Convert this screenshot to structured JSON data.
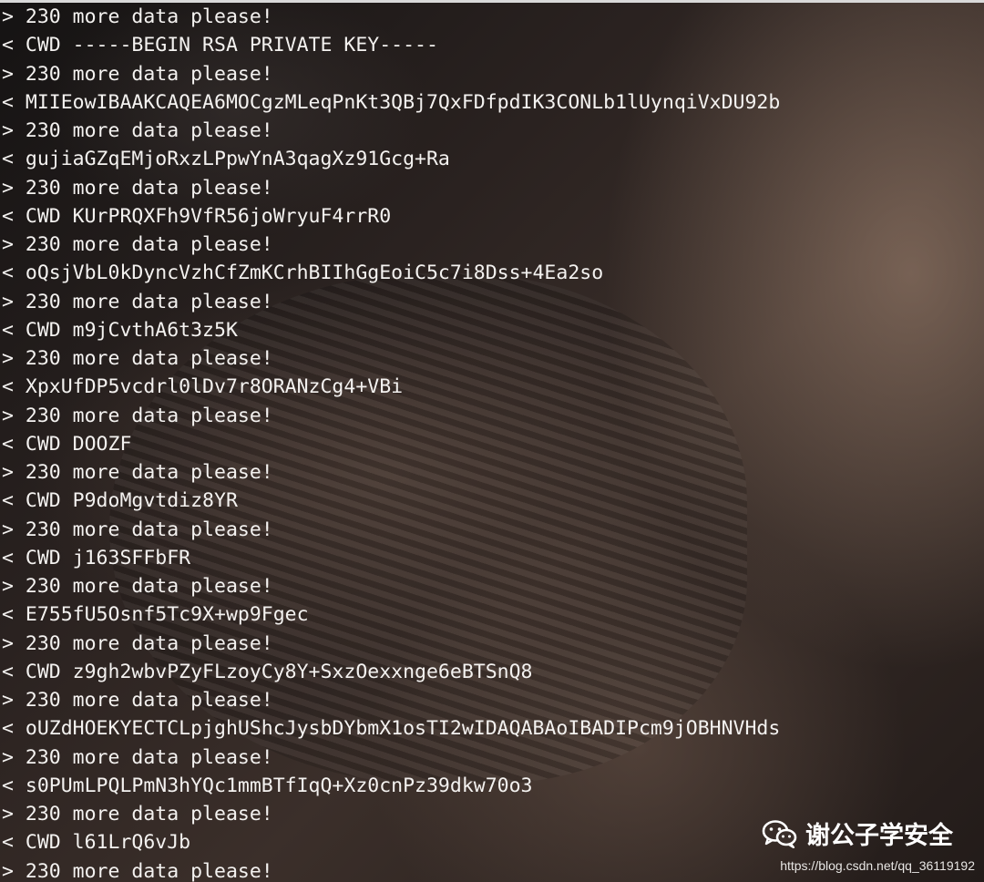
{
  "terminal": {
    "lines": [
      "> 230 more data please!",
      "< CWD -----BEGIN RSA PRIVATE KEY-----",
      "> 230 more data please!",
      "< MIIEowIBAAKCAQEA6MOCgzMLeqPnKt3QBj7QxFDfpdIK3CONLb1lUynqiVxDU92b",
      "> 230 more data please!",
      "< gujiaGZqEMjoRxzLPpwYnA3qagXz91Gcg+Ra",
      "> 230 more data please!",
      "< CWD KUrPRQXFh9VfR56joWryuF4rrR0",
      "> 230 more data please!",
      "< oQsjVbL0kDyncVzhCfZmKCrhBIIhGgEoiC5c7i8Dss+4Ea2so",
      "> 230 more data please!",
      "< CWD m9jCvthA6t3z5K",
      "> 230 more data please!",
      "< XpxUfDP5vcdrl0lDv7r8ORANzCg4+VBi",
      "> 230 more data please!",
      "< CWD DOOZF",
      "> 230 more data please!",
      "< CWD P9doMgvtdiz8YR",
      "> 230 more data please!",
      "< CWD j163SFFbFR",
      "> 230 more data please!",
      "< E755fU5Osnf5Tc9X+wp9Fgec",
      "> 230 more data please!",
      "< CWD z9gh2wbvPZyFLzoyCy8Y+SxzOexxnge6eBTSnQ8",
      "> 230 more data please!",
      "< oUZdHOEKYECTCLpjghUShcJysbDYbmX1osTI2wIDAQABAoIBADIPcm9jOBHNVHds",
      "> 230 more data please!",
      "< s0PUmLPQLPmN3hYQc1mmBTfIqQ+Xz0cnPz39dkw70o3",
      "> 230 more data please!",
      "< CWD l61LrQ6vJb",
      "> 230 more data please!"
    ]
  },
  "watermark": {
    "icon": "wechat-icon",
    "text": "谢公子学安全",
    "url": "https://blog.csdn.net/qq_36119192"
  },
  "colors": {
    "text": "#f4f2f0",
    "background": "#2a2220",
    "top_bar": "#d9d9d9"
  }
}
